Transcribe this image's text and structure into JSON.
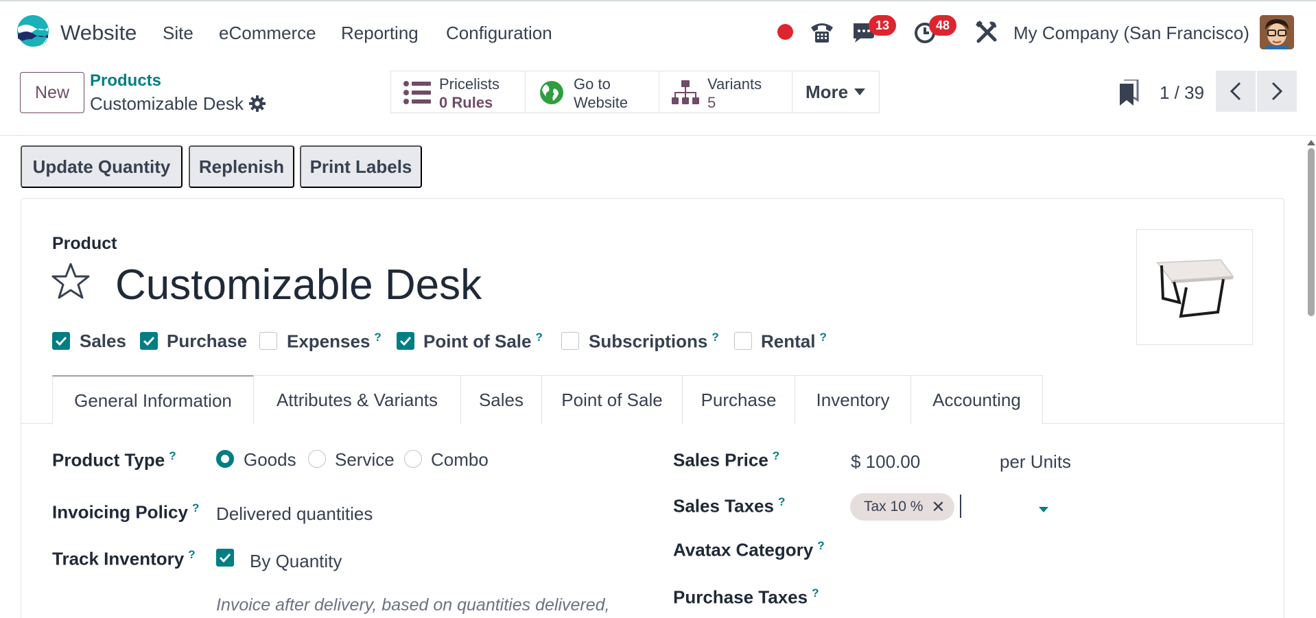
{
  "navbar": {
    "app_name": "Website",
    "menus": [
      "Site",
      "eCommerce",
      "Reporting",
      "Configuration"
    ],
    "messages_count": "13",
    "activities_count": "48",
    "company": "My Company (San Francisco)"
  },
  "control_panel": {
    "new_label": "New",
    "breadcrumb_parent": "Products",
    "breadcrumb_current": "Customizable Desk",
    "smart_buttons": {
      "pricelists": {
        "line1": "Pricelists",
        "count": "0",
        "line2": "Rules"
      },
      "website": {
        "line1": "Go to",
        "line2": "Website"
      },
      "variants": {
        "line1": "Variants",
        "count": "5"
      }
    },
    "more_label": "More",
    "pager": "1 / 39"
  },
  "actions": [
    "Update Quantity",
    "Replenish",
    "Print Labels"
  ],
  "form": {
    "product_label": "Product",
    "product_name": "Customizable Desk",
    "flags": [
      {
        "label": "Sales",
        "checked": true,
        "help": false
      },
      {
        "label": "Purchase",
        "checked": true,
        "help": false
      },
      {
        "label": "Expenses",
        "checked": false,
        "help": true
      },
      {
        "label": "Point of Sale",
        "checked": true,
        "help": true
      },
      {
        "label": "Subscriptions",
        "checked": false,
        "help": true
      },
      {
        "label": "Rental",
        "checked": false,
        "help": true
      }
    ],
    "help_mark": "?",
    "tabs": [
      "General Information",
      "Attributes & Variants",
      "Sales",
      "Point of Sale",
      "Purchase",
      "Inventory",
      "Accounting"
    ],
    "active_tab": "General Information",
    "fields": {
      "product_type_label": "Product Type",
      "product_type_options": [
        "Goods",
        "Service",
        "Combo"
      ],
      "product_type_selected": "Goods",
      "invoicing_policy_label": "Invoicing Policy",
      "invoicing_policy_value": "Delivered quantities",
      "track_inventory_label": "Track Inventory",
      "track_inventory_value": "By Quantity",
      "invoice_help": "Invoice after delivery, based on quantities delivered,",
      "sales_price_label": "Sales Price",
      "sales_price_value": "$ 100.00",
      "sales_price_unit": "per Units",
      "sales_taxes_label": "Sales Taxes",
      "sales_taxes_tag": "Tax 10 %",
      "avatax_label": "Avatax Category",
      "purchase_taxes_label": "Purchase Taxes"
    }
  },
  "colors": {
    "primary": "#714b67",
    "accent": "#017e84",
    "badge": "#e0242f"
  }
}
